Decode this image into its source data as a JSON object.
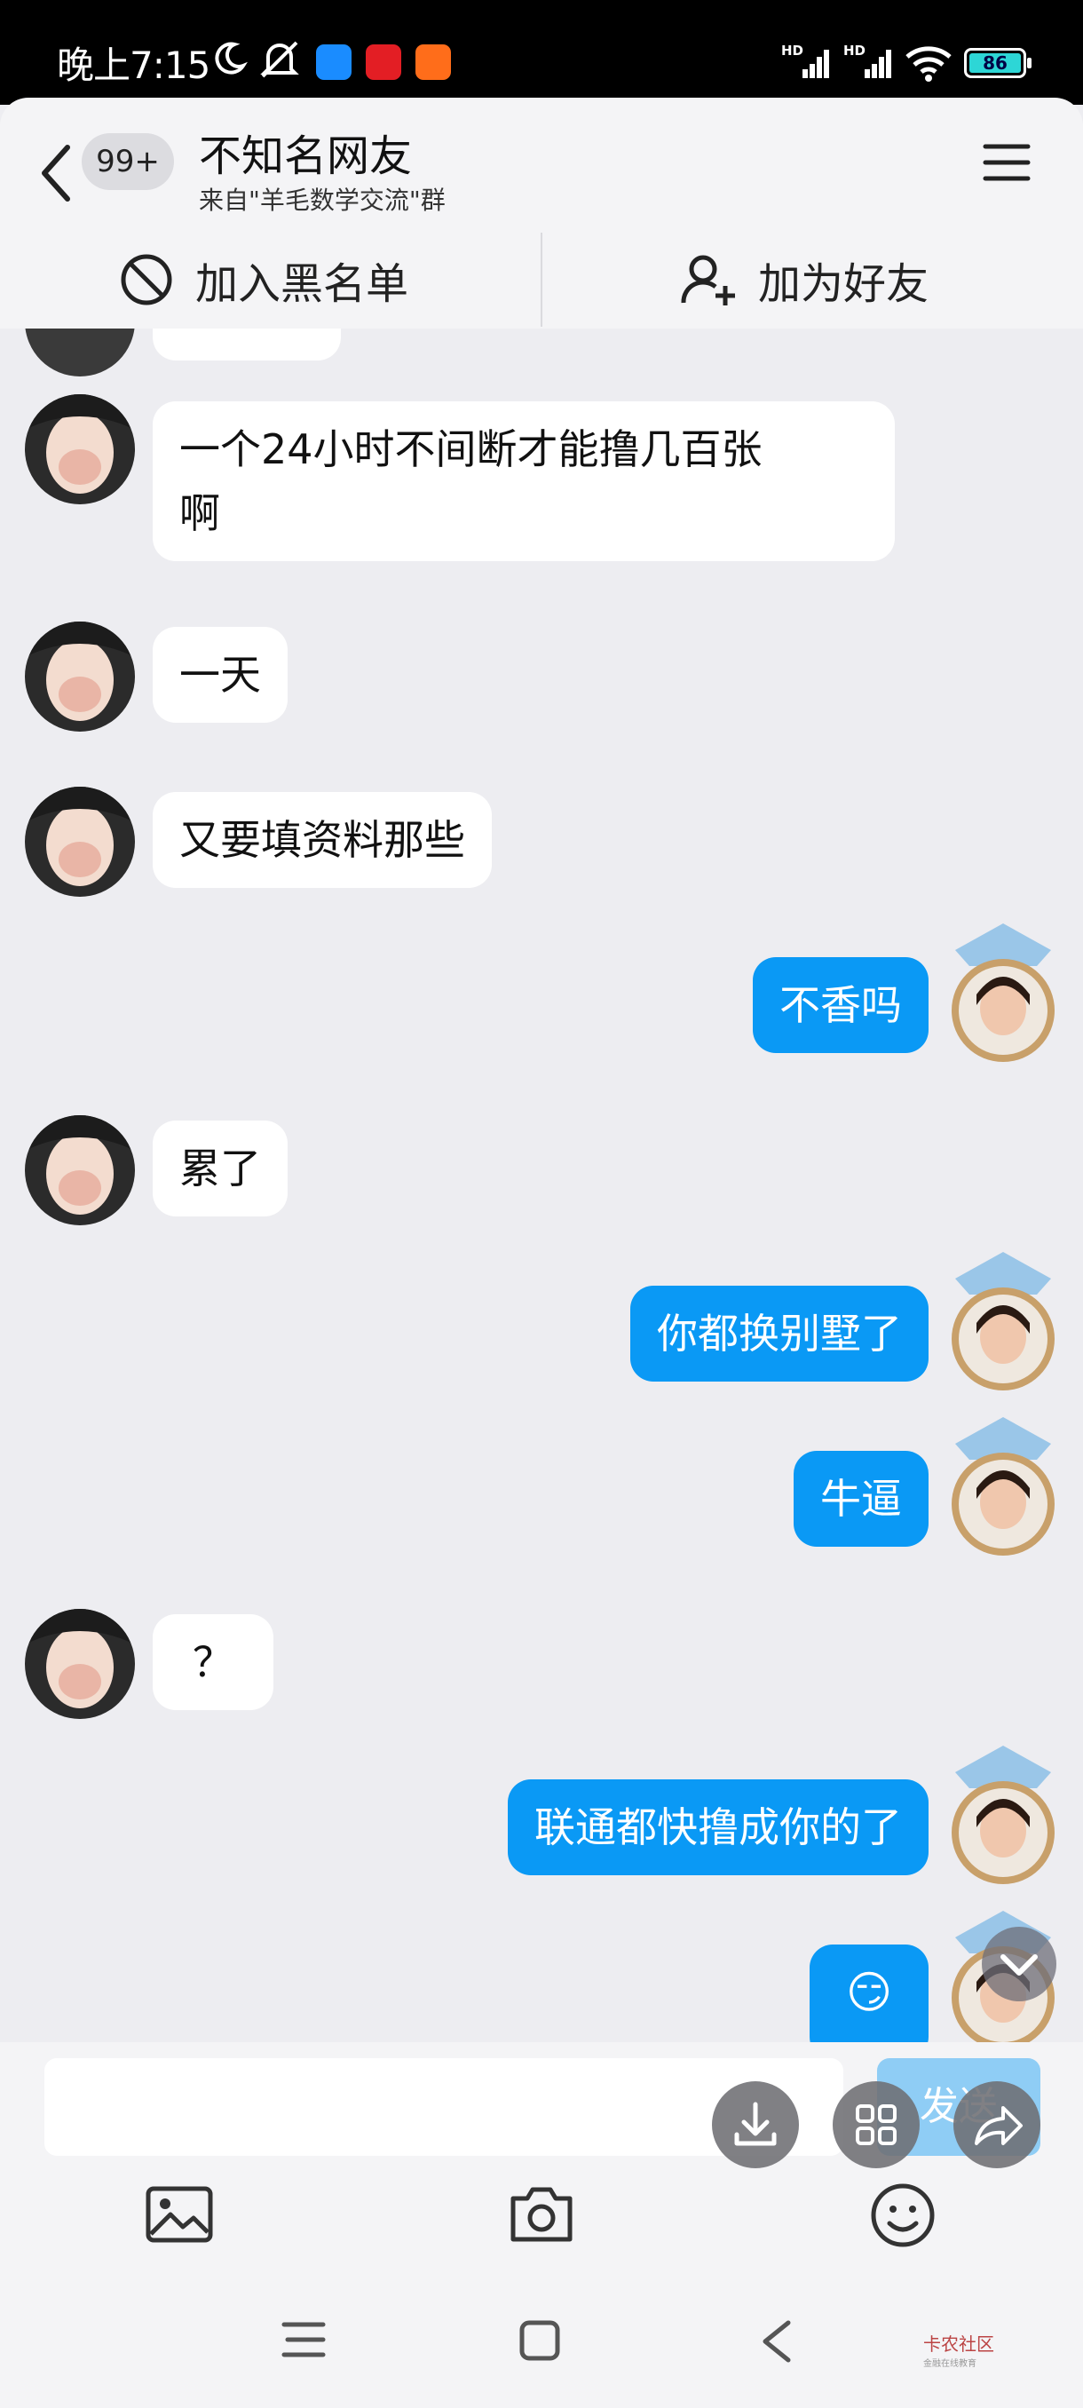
{
  "status": {
    "time": "晚上7:15",
    "hd1": "HD",
    "hd2": "HD",
    "battery": "86"
  },
  "header": {
    "unread_badge": "99+",
    "title": "不知名网友",
    "subtitle": "来自\"羊毛数学交流\"群",
    "blacklist_label": "加入黑名单",
    "add_friend_label": "加为好友"
  },
  "messages": [
    {
      "side": "in",
      "text": "一个24小时不间断才能撸几百张\n啊"
    },
    {
      "side": "in",
      "text": "一天"
    },
    {
      "side": "in",
      "text": "又要填资料那些"
    },
    {
      "side": "out",
      "text": "不香吗"
    },
    {
      "side": "in",
      "text": "累了"
    },
    {
      "side": "out",
      "text": "你都换别墅了"
    },
    {
      "side": "out",
      "text": "牛逼"
    },
    {
      "side": "in",
      "text": "？"
    },
    {
      "side": "out",
      "text": "联通都快撸成你的了"
    },
    {
      "side": "out",
      "text": "😏"
    }
  ],
  "input": {
    "send_label": "发送"
  },
  "watermark": {
    "brand": "卡农社区",
    "tagline": "金融在线教育"
  },
  "colors": {
    "outgoing_bubble": "#0a99f5",
    "incoming_bubble": "#ffffff",
    "background": "#ededf1"
  }
}
